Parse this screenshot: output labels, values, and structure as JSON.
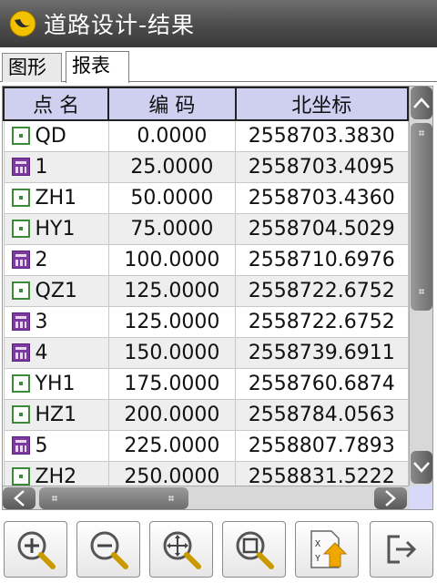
{
  "window": {
    "title": "道路设计-结果"
  },
  "tabs": [
    {
      "label": "图形"
    },
    {
      "label": "报表"
    }
  ],
  "table": {
    "columns": [
      "点 名",
      "编 码",
      "北坐标"
    ],
    "rows": [
      {
        "type": "standard",
        "name": "QD",
        "code": "0.0000",
        "north": "2558703.3830"
      },
      {
        "type": "calc",
        "name": "1",
        "code": "25.0000",
        "north": "2558703.4095"
      },
      {
        "type": "standard",
        "name": "ZH1",
        "code": "50.0000",
        "north": "2558703.4360"
      },
      {
        "type": "standard",
        "name": "HY1",
        "code": "75.0000",
        "north": "2558704.5029"
      },
      {
        "type": "calc",
        "name": "2",
        "code": "100.0000",
        "north": "2558710.6976"
      },
      {
        "type": "standard",
        "name": "QZ1",
        "code": "125.0000",
        "north": "2558722.6752"
      },
      {
        "type": "calc",
        "name": "3",
        "code": "125.0000",
        "north": "2558722.6752"
      },
      {
        "type": "calc",
        "name": "4",
        "code": "150.0000",
        "north": "2558739.6911"
      },
      {
        "type": "standard",
        "name": "YH1",
        "code": "175.0000",
        "north": "2558760.6874"
      },
      {
        "type": "standard",
        "name": "HZ1",
        "code": "200.0000",
        "north": "2558784.0563"
      },
      {
        "type": "calc",
        "name": "5",
        "code": "225.0000",
        "north": "2558807.7893"
      },
      {
        "type": "standard",
        "name": "ZH2",
        "code": "250.0000",
        "north": "2558831.5222"
      }
    ]
  },
  "toolbar": {
    "buttons": [
      {
        "icon": "zoom-in-icon"
      },
      {
        "icon": "zoom-out-icon"
      },
      {
        "icon": "pan-icon"
      },
      {
        "icon": "zoom-extent-icon"
      },
      {
        "icon": "export-icon",
        "label_x": "X",
        "label_y": "Y"
      },
      {
        "icon": "exit-icon"
      }
    ]
  }
}
